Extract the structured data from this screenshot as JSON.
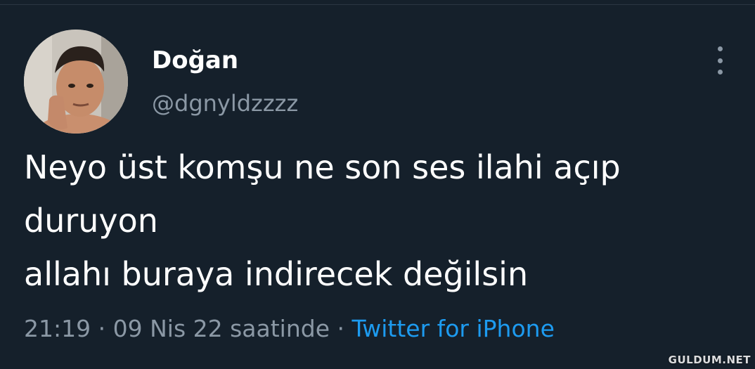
{
  "tweet": {
    "author": {
      "display_name": "Doğan",
      "handle": "@dgnyldzzzz",
      "avatar_icon": "profile-photo"
    },
    "text_lines": [
      "Neyo üst komşu ne son ses ilahi açıp",
      "duruyon",
      "allahı buraya indirecek değilsin"
    ],
    "time": "21:19",
    "separator": "·",
    "date": "09 Nis 22 saatinde",
    "source": "Twitter for iPhone",
    "more_icon": "more-vertical-icon"
  },
  "watermark": "GULDUM.NET",
  "colors": {
    "background": "#15202b",
    "primary_text": "#ffffff",
    "secondary_text": "#8b98a5",
    "link": "#1d9bf0"
  }
}
